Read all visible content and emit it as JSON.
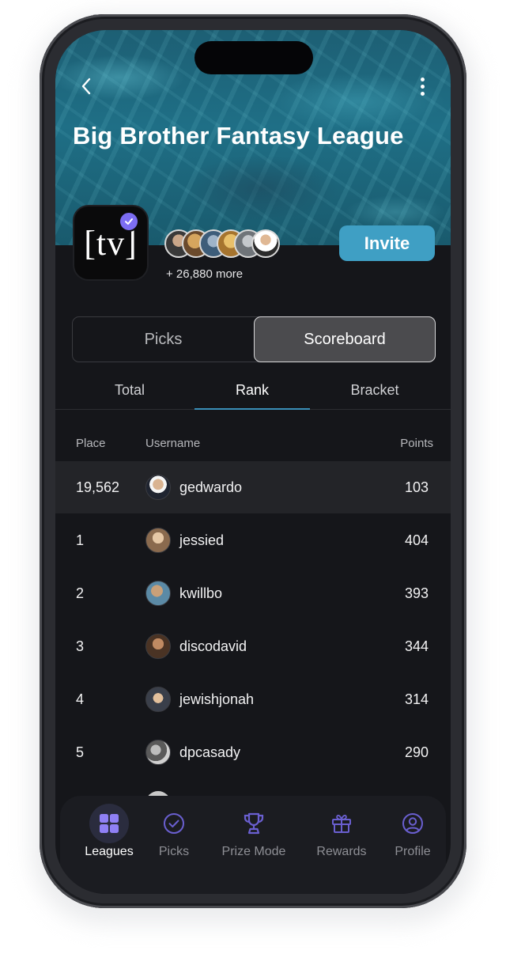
{
  "header": {
    "title": "Big Brother Fantasy League",
    "logo_text": "[tv]",
    "members_more": "+ 26,880 more",
    "invite_label": "Invite"
  },
  "segments": [
    {
      "label": "Picks",
      "active": false
    },
    {
      "label": "Scoreboard",
      "active": true
    }
  ],
  "subtabs": [
    {
      "label": "Total",
      "active": false
    },
    {
      "label": "Rank",
      "active": true
    },
    {
      "label": "Bracket",
      "active": false
    }
  ],
  "table": {
    "headers": {
      "place": "Place",
      "username": "Username",
      "points": "Points"
    },
    "rows": [
      {
        "place": "19,562",
        "username": "gedwardo",
        "points": "103",
        "current_user": true
      },
      {
        "place": "1",
        "username": "jessied",
        "points": "404"
      },
      {
        "place": "2",
        "username": "kwillbo",
        "points": "393"
      },
      {
        "place": "3",
        "username": "discodavid",
        "points": "344"
      },
      {
        "place": "4",
        "username": "jewishjonah",
        "points": "314"
      },
      {
        "place": "5",
        "username": "dpcasady",
        "points": "290"
      }
    ]
  },
  "tabbar": [
    {
      "label": "Leagues",
      "icon": "grid-icon",
      "active": true
    },
    {
      "label": "Picks",
      "icon": "check-circle-icon",
      "active": false
    },
    {
      "label": "Prize Mode",
      "icon": "trophy-icon",
      "active": false
    },
    {
      "label": "Rewards",
      "icon": "gift-icon",
      "active": false
    },
    {
      "label": "Profile",
      "icon": "user-circle-icon",
      "active": false
    }
  ],
  "colors": {
    "accent": "#3f9fc4",
    "tab_active": "#7b6cf0",
    "background": "#15161a"
  }
}
